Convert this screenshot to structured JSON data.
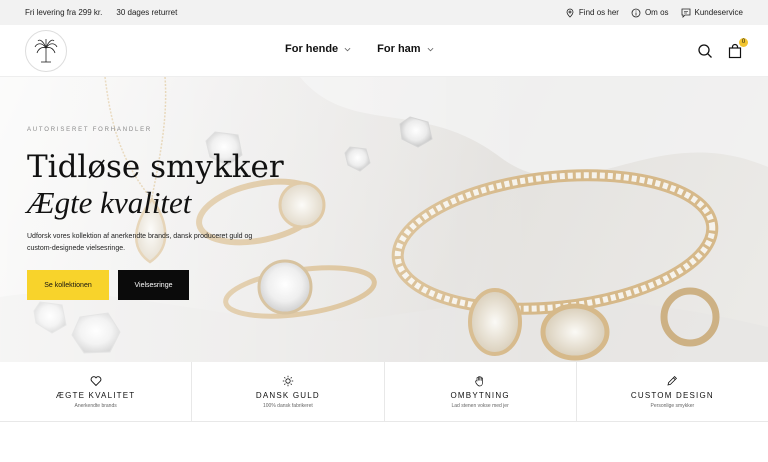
{
  "topbar": {
    "left": [
      "Fri levering fra 299 kr.",
      "30 dages returret"
    ],
    "right": [
      {
        "label": "Find os her",
        "icon": "location-pin-icon"
      },
      {
        "label": "Om os",
        "icon": "info-icon"
      },
      {
        "label": "Kundeservice",
        "icon": "chat-icon"
      }
    ]
  },
  "header": {
    "logo": "palm-tree-logo",
    "nav": [
      {
        "label": "For hende"
      },
      {
        "label": "For ham"
      }
    ],
    "cart_count": "0"
  },
  "hero": {
    "eyebrow": "AUTORISERET FORHANDLER",
    "title_line1": "Tidløse smykker",
    "title_line2": "Ægte kvalitet",
    "description": "Udforsk vores kollektion af anerkendte brands, dansk produceret guld og custom-designede vielsesringe.",
    "primary_button": "Se kollektionen",
    "secondary_button": "Vielsesringe"
  },
  "features": [
    {
      "title": "ÆGTE KVALITET",
      "subtitle": "Anerkendte brands",
      "icon": "heart-icon"
    },
    {
      "title": "DANSK GULD",
      "subtitle": "100% dansk fabrikeret",
      "icon": "sun-icon"
    },
    {
      "title": "OMBYTNING",
      "subtitle": "Lad stenen vokse med jer",
      "icon": "hand-icon"
    },
    {
      "title": "CUSTOM DESIGN",
      "subtitle": "Personlige smykker",
      "icon": "pen-icon"
    }
  ],
  "colors": {
    "accent_yellow": "#f8d32b",
    "button_black": "#0b0b0b",
    "topbar_bg": "#f2f2f2",
    "gold": "#d6b98a"
  }
}
